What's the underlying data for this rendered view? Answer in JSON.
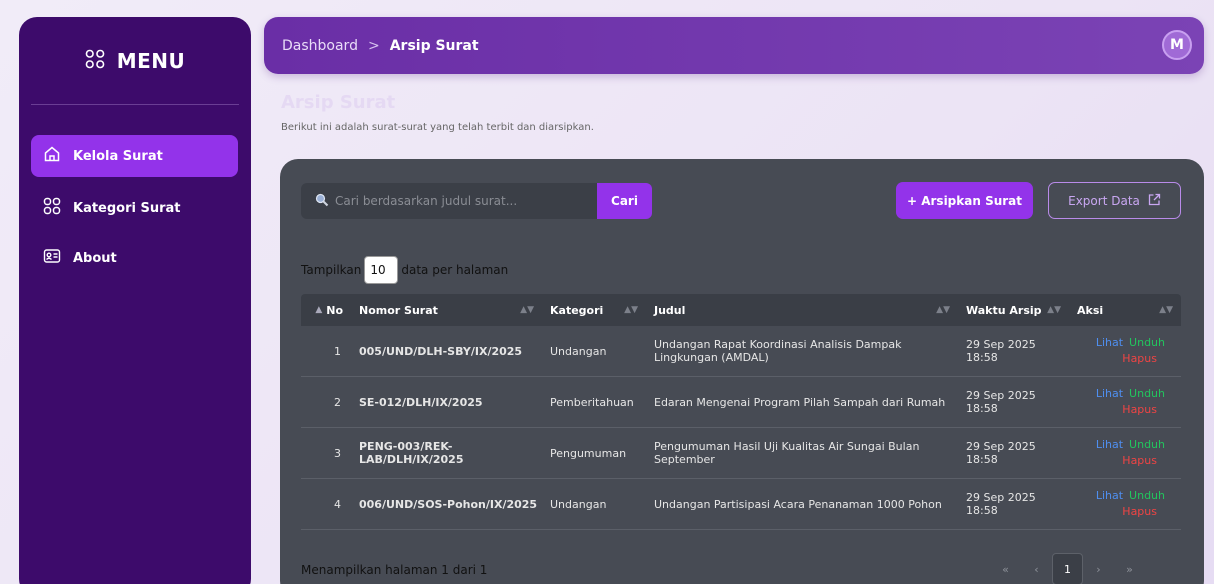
{
  "sidebar": {
    "title": "MENU",
    "items": [
      {
        "label": "Kelola Surat",
        "icon": "home-icon",
        "active": true
      },
      {
        "label": "Kategori Surat",
        "icon": "grid-icon",
        "active": false
      },
      {
        "label": "About",
        "icon": "id-card-icon",
        "active": false
      }
    ]
  },
  "header": {
    "breadcrumb": [
      "Dashboard",
      "Arsip Surat"
    ],
    "breadcrumb_separator": ">",
    "avatar_initial": "M"
  },
  "page": {
    "title": "Arsip Surat",
    "subtitle": "Berikut ini adalah surat-surat yang telah terbit dan diarsipkan."
  },
  "toolbar": {
    "search_placeholder": "Cari berdasarkan judul surat...",
    "search_button": "Cari",
    "archive_button": "+ Arsipkan Surat",
    "export_button": "Export Data"
  },
  "length": {
    "prefix": "Tampilkan",
    "value": "10",
    "suffix": "data per halaman"
  },
  "table": {
    "headers": [
      "No",
      "Nomor Surat",
      "Kategori",
      "Judul",
      "Waktu Arsip",
      "Aksi"
    ],
    "rows": [
      {
        "no": "1",
        "nomor": "005/UND/DLH-SBY/IX/2025",
        "kategori": "Undangan",
        "judul": "Undangan Rapat Koordinasi Analisis Dampak Lingkungan (AMDAL)",
        "waktu": "29 Sep 2025 18:58"
      },
      {
        "no": "2",
        "nomor": "SE-012/DLH/IX/2025",
        "kategori": "Pemberitahuan",
        "judul": "Edaran Mengenai Program Pilah Sampah dari Rumah",
        "waktu": "29 Sep 2025 18:58"
      },
      {
        "no": "3",
        "nomor": "PENG-003/REK-LAB/DLH/IX/2025",
        "kategori": "Pengumuman",
        "judul": "Pengumuman Hasil Uji Kualitas Air Sungai Bulan September",
        "waktu": "29 Sep 2025 18:58"
      },
      {
        "no": "4",
        "nomor": "006/UND/SOS-Pohon/IX/2025",
        "kategori": "Undangan",
        "judul": "Undangan Partisipasi Acara Penanaman 1000 Pohon",
        "waktu": "29 Sep 2025 18:58"
      }
    ],
    "actions": {
      "view": "Lihat",
      "download": "Unduh",
      "delete": "Hapus"
    }
  },
  "footer": {
    "info": "Menampilkan halaman 1 dari 1",
    "pagination": {
      "first": "«",
      "prev": "‹",
      "current": "1",
      "next": "›",
      "last": "»"
    }
  },
  "colors": {
    "sidebar_bg": "#3d0b6b",
    "accent": "#9333ea",
    "panel_bg": "#474b54",
    "link_view": "#4f8ff0",
    "link_download": "#22c55e",
    "link_delete": "#ef4444"
  }
}
